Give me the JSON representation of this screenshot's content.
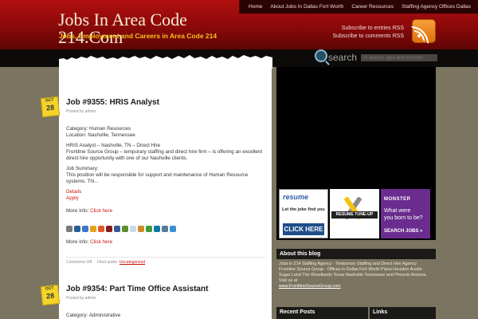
{
  "nav": {
    "items": [
      "Home",
      "About Jobs In Dallas Fort Worth",
      "Career Resources",
      "Staffing Agency Offices Dallas"
    ]
  },
  "site": {
    "title_line1": "Jobs In Area Code",
    "title_line2": "214.Com",
    "tagline": "Jobs, Employment and Careers in Area Code 214"
  },
  "subscribe": {
    "entries": "Subscribe to entries RSS",
    "comments": "Subscribe to comments RSS"
  },
  "search": {
    "label": "search",
    "placeholder": "To search, type and hit enter"
  },
  "posts": [
    {
      "month": "OCT",
      "day": "28",
      "title": "Job #9355: HRIS Analyst",
      "meta": "Posted by admin",
      "category": "Category: Human Resources",
      "location": "Location: Nashville, Tennessee",
      "p1": "HRIS Analyst – Nashville, TN – Direct Hire",
      "p2": "Frontline Source Group – temporary staffing and direct hire firm – is offering an excellent direct hire opportunity with one of our Nashville clients.",
      "summary_label": "Job Summary:",
      "summary": "This position will be responsible for support and maintenance of Human Resource systems. Thi...",
      "details": "Details",
      "apply": "Apply",
      "more_label": "More Info:",
      "more_link": "Click here",
      "comments": "Comments Off",
      "filed": "Filed under:",
      "filed_cat": "Uncategorized"
    },
    {
      "month": "OCT",
      "day": "28",
      "title": "Job #9354: Part Time Office Assistant",
      "meta": "Posted by admin",
      "category": "Category: Administrative"
    }
  ],
  "sidebar": {
    "ads": [
      {
        "line1": "resume",
        "line2": "Let the jobs find you",
        "cta": "CLICK HERE"
      },
      {
        "label": "RESUME TUNE-UP"
      },
      {
        "brand": "MONSTER",
        "line1": "What were",
        "line2": "you born to be?",
        "cta": "SEARCH JOBS »"
      }
    ],
    "about_title": "About this blog",
    "about_text": "Jobs in 214 Staffing Agency - Temporary Staffing and Direct Hire Agency Frontline Source Group - Offices in Dallas Fort Worth Plano Houston Austin Sugar Land The Woodlands Texas Nashville Tennessee and Phoenix Arizona. Visit us at",
    "about_link": "www.FrontlineSourceGroup.com",
    "recent_title": "Recent Posts",
    "links_title": "Links"
  }
}
